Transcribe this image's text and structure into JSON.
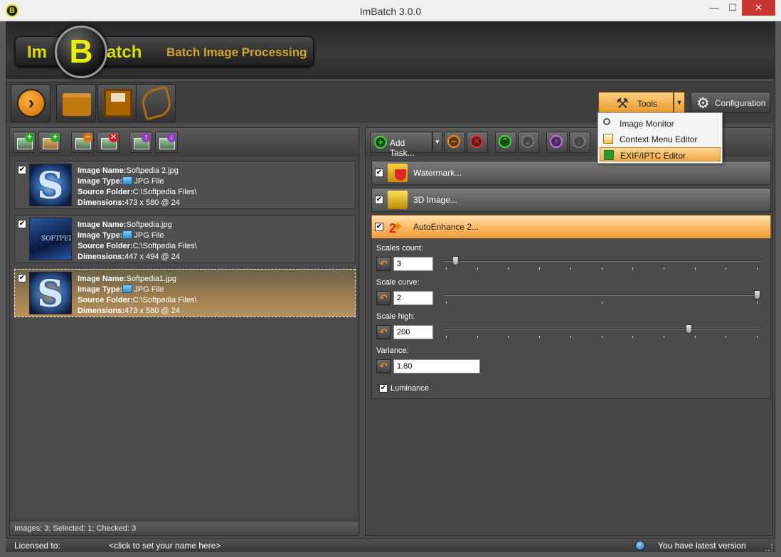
{
  "window": {
    "title": "ImBatch 3.0.0",
    "app_icon_letter": "B",
    "minimize_glyph": "—",
    "maximize_glyph": "☐",
    "close_glyph": "✕"
  },
  "banner": {
    "logo_left": "Im",
    "logo_center": "B",
    "logo_right": "atch",
    "subtitle": "Batch Image Processing"
  },
  "toolbar": {
    "buttons": [
      {
        "name": "run-batch",
        "icon": "play-circle-icon"
      },
      {
        "name": "open-task-list",
        "icon": "folder-icon"
      },
      {
        "name": "save-task-list",
        "icon": "floppy-disk-icon"
      },
      {
        "name": "preview",
        "icon": "eye-icon"
      }
    ],
    "tools_label": "Tools",
    "tools_icon": "⚒",
    "tools_arrow": "▼",
    "config_label": "Configuration",
    "config_icon": "⚙"
  },
  "tools_menu": {
    "items": [
      {
        "label": "Image Monitor",
        "icon": "magnifier-icon",
        "highlighted": false
      },
      {
        "label": "Context Menu Editor",
        "icon": "context-menu-icon",
        "highlighted": false
      },
      {
        "label": "EXIF/IPTC Editor",
        "icon": "exif-editor-icon",
        "highlighted": true
      }
    ]
  },
  "image_toolbar": {
    "buttons": [
      {
        "name": "add-images",
        "badge": "+"
      },
      {
        "name": "add-folder",
        "badge": "+"
      },
      {
        "name": "remove-selected",
        "badge": "−"
      },
      {
        "name": "remove-all",
        "badge": "✕"
      },
      {
        "name": "move-up",
        "badge": "↑"
      },
      {
        "name": "move-down",
        "badge": "↓"
      }
    ]
  },
  "image_labels": {
    "name": "Image Name:",
    "type": "Image Type:",
    "folder": "Source Folder:",
    "dims": "Dimensions:"
  },
  "images": [
    {
      "checked": "✔",
      "name": "Softpedia 2.jpg",
      "type": "JPG File",
      "folder": "C:\\Softpedia Files\\",
      "dimensions": "473 x 580 @ 24",
      "thumb_text": "S",
      "selected": false
    },
    {
      "checked": "✔",
      "name": "Softpedia.jpg",
      "type": "JPG File",
      "folder": "C:\\Softpedia Files\\",
      "dimensions": "447 x 494 @ 24",
      "thumb_text": "SOFTPEDIA",
      "selected": false
    },
    {
      "checked": "✔",
      "name": "Softpedia1.jpg",
      "type": "JPG File",
      "folder": "C:\\Softpedia Files\\",
      "dimensions": "473 x 580 @ 24",
      "thumb_text": "S",
      "selected": true
    }
  ],
  "images_status": "Images: 3; Selected: 1; Checked: 3",
  "task_toolbar": {
    "add_task_label": "Add Task...",
    "add_icon": "+",
    "dropdown_arrow": "▼",
    "buttons": [
      {
        "name": "remove-task",
        "glyph": "−",
        "color": "orange"
      },
      {
        "name": "remove-all-tasks",
        "glyph": "✕",
        "color": "red"
      },
      {
        "name": "expand-task",
        "glyph": "⌃",
        "color": "green"
      },
      {
        "name": "collapse-task",
        "glyph": "⌄",
        "color": "grey"
      },
      {
        "name": "move-task-up",
        "glyph": "↑",
        "color": "purple"
      },
      {
        "name": "move-task-down",
        "glyph": "↓",
        "color": "grey"
      }
    ]
  },
  "tasks": [
    {
      "label": "Watermark...",
      "checked": "✔",
      "icon": "watermark-icon",
      "active": false
    },
    {
      "label": "3D Image...",
      "checked": "✔",
      "icon": "3d-image-icon",
      "active": false
    },
    {
      "label": "AutoEnhance 2...",
      "checked": "✔",
      "icon": "magic-wand-icon",
      "active": true
    }
  ],
  "autoenhance": {
    "reset_glyph": "↶",
    "scales_count": {
      "label": "Scales count:",
      "value": "3",
      "min": 1,
      "max": 11,
      "level": 0.03
    },
    "scale_curve": {
      "label": "Scale curve:",
      "value": "2",
      "min": 0,
      "max": 2,
      "level": 1.0
    },
    "scale_high": {
      "label": "Scale high:",
      "value": "200",
      "min": 0,
      "max": 255,
      "level": 0.78
    },
    "variance": {
      "label": "Variance:",
      "value": "1.80"
    },
    "luminance": {
      "label": "Luminance",
      "checked": "✔"
    }
  },
  "statusbar": {
    "licensed_label": "Licensed to:",
    "name_prompt": "<click to set your name here>",
    "version_text": "You have latest version"
  },
  "colors": {
    "accent": "#f0a040",
    "background": "#4b4b4b",
    "selection": "#b89060"
  }
}
